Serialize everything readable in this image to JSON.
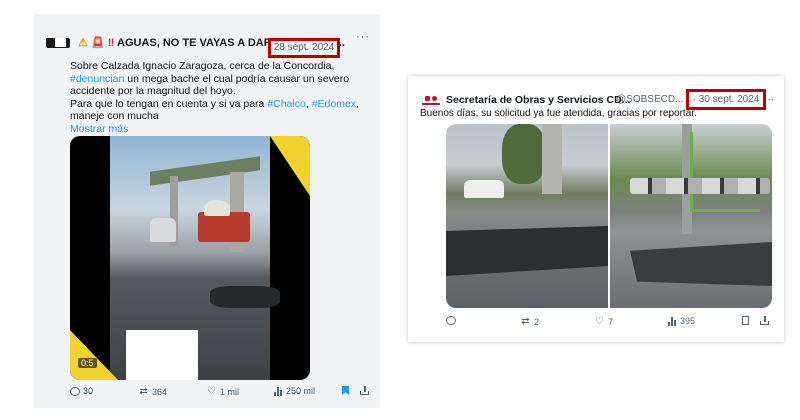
{
  "left_tweet": {
    "header_prefix_icons": [
      "warning-icon",
      "siren-icon",
      "double-exclamation-icon"
    ],
    "header_text": "AGUAS, NO TE VAYAS A DAR EN TU MAD...",
    "date": "28 sept. 2024",
    "more_label": "···",
    "body_line1_start": "Sobre Calzada Ignacio Zaragoza, cerca de la Concordia, ",
    "hashtag_denuncian": "#denuncian",
    "body_line1_end": " un mega bache el cual podría causar un severo accidente por la magnitud del hoyo.",
    "body_line2_start": "Para que lo tengan en cuenta y si va para ",
    "hashtag_chalco": "#Chalco",
    "comma": ", ",
    "hashtag_edomex": "#Edomex",
    "body_line2_end": ", maneje con mucha",
    "show_more": "Mostrar más",
    "video_time": "0:5",
    "actions": {
      "replies": "30",
      "reposts": "364",
      "likes": "1 mil",
      "views": "250 mil"
    }
  },
  "right_tweet": {
    "name": "Secretaría de Obras y Servicios CD...",
    "handle": "@SOBSECD...",
    "date": "· 30 sept. 2024",
    "more_label": "···",
    "text": "Buenos días, su solicitud ya fue atendida, gracias por reportar.",
    "actions": {
      "replies": "",
      "reposts": "2",
      "likes": "7",
      "views": "395"
    }
  },
  "colors": {
    "highlight_box": "#c00000",
    "link": "#1d9bf0",
    "muted": "#536471"
  }
}
